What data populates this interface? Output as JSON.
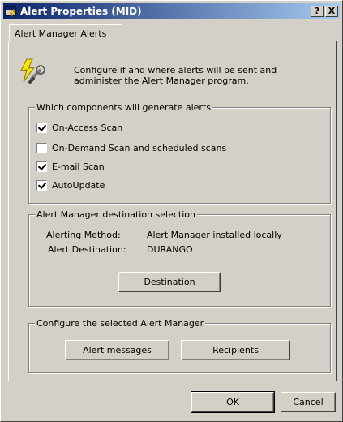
{
  "window": {
    "title": "Alert Properties (MID)",
    "help_label": "?",
    "close_label": "X"
  },
  "tab": {
    "label": "Alert Manager Alerts"
  },
  "intro": {
    "text": "Configure if and where alerts will be sent and administer the Alert Manager program."
  },
  "components_group": {
    "title": "Which components will generate alerts",
    "items": [
      {
        "label": "On-Access Scan",
        "checked": true
      },
      {
        "label": "On-Demand Scan and scheduled scans",
        "checked": false
      },
      {
        "label": "E-mail Scan",
        "checked": true
      },
      {
        "label": "AutoUpdate",
        "checked": true
      }
    ]
  },
  "destination_group": {
    "title": "Alert Manager destination selection",
    "method_label": "Alerting Method:",
    "method_value": "Alert Manager installed locally",
    "dest_label": "Alert Destination:",
    "dest_value": "DURANGO",
    "destination_button": "Destination"
  },
  "configure_group": {
    "title": "Configure the selected Alert Manager",
    "messages_button": "Alert messages",
    "recipients_button": "Recipients"
  },
  "footer": {
    "ok_label": "OK",
    "cancel_label": "Cancel"
  }
}
